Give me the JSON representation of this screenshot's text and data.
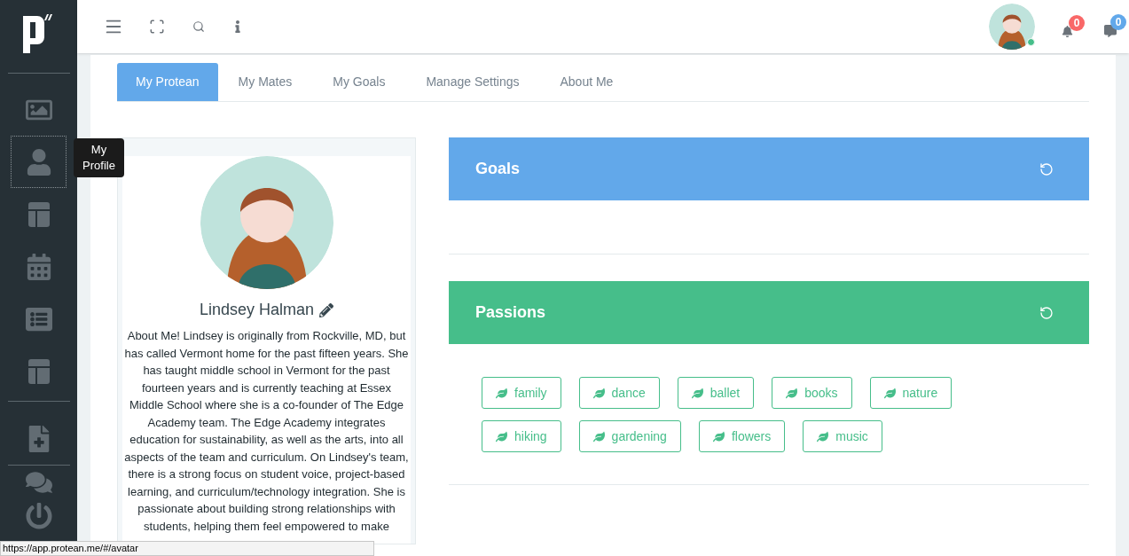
{
  "sidebar": {
    "items": [
      {
        "selected": false
      },
      {
        "selected": true
      },
      {
        "selected": false
      },
      {
        "selected": false
      },
      {
        "selected": false
      },
      {
        "selected": false
      },
      {
        "selected": false
      },
      {
        "selected": false
      },
      {
        "selected": false
      }
    ],
    "tooltip": "My Profile"
  },
  "header": {
    "user": {
      "online": true
    },
    "notifications": {
      "count": "0"
    },
    "messages": {
      "count": "0"
    }
  },
  "tabs": [
    {
      "label": "My Protean",
      "selected": true
    },
    {
      "label": "My Mates",
      "selected": false
    },
    {
      "label": "My Goals",
      "selected": false
    },
    {
      "label": "Manage Settings",
      "selected": false
    },
    {
      "label": "About Me",
      "selected": false
    }
  ],
  "profile": {
    "name": "Lindsey Halman",
    "bio": "About Me! Lindsey is originally from Rockville, MD, but has called Vermont home for the past fifteen years. She has taught middle school in Vermont for the past fourteen years and is currently teaching at Essex Middle School where she is a co-founder of The Edge Academy team. The Edge Academy integrates education for sustainability, as well as the arts, into all aspects of the team and curriculum. On Lindsey's team, there is a strong focus on student voice, project-based learning, and curriculum/technology integration. She is passionate about building strong relationships with students, helping them feel empowered to make"
  },
  "panels": [
    {
      "title": "Goals",
      "color": "#62a8ea"
    },
    {
      "title": "Passions",
      "color": "#46be8a",
      "tags": [
        "family",
        "dance",
        "ballet",
        "books",
        "nature",
        "hiking",
        "gardening",
        "flowers",
        "music"
      ]
    }
  ],
  "status_bar": {
    "url": "https://app.protean.me/#/avatar"
  }
}
